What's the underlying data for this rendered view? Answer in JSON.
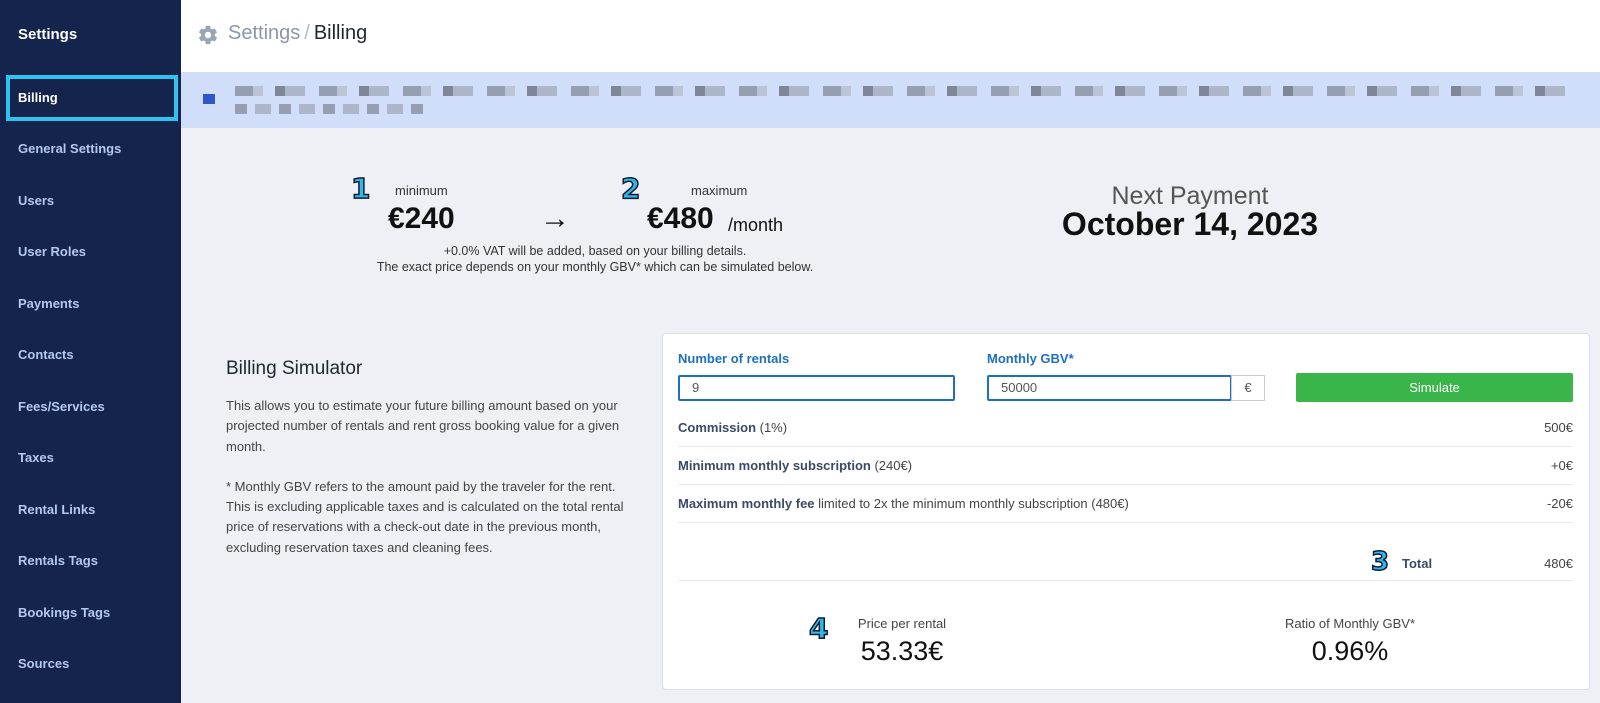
{
  "sidebar": {
    "title": "Settings",
    "items": [
      {
        "label": "Billing",
        "active": true
      },
      {
        "label": "General Settings"
      },
      {
        "label": "Users"
      },
      {
        "label": "User Roles"
      },
      {
        "label": "Payments"
      },
      {
        "label": "Contacts"
      },
      {
        "label": "Fees/Services"
      },
      {
        "label": "Taxes"
      },
      {
        "label": "Rental Links"
      },
      {
        "label": "Rentals Tags"
      },
      {
        "label": "Bookings Tags"
      },
      {
        "label": "Sources"
      }
    ]
  },
  "header": {
    "crumb_parent": "Settings",
    "crumb_sep": "/",
    "crumb_current": "Billing",
    "icon": "gear-icon"
  },
  "banner": {
    "icon": "info-square-icon"
  },
  "pricing": {
    "badge_min": "1",
    "badge_max": "2",
    "min_label": "minimum",
    "min_price": "€240",
    "arrow": "→",
    "max_label": "maximum",
    "max_price": "€480",
    "per_month": "/month",
    "vat_note": "+0.0% VAT will be added, based on your billing details.",
    "gbv_note": "The exact price depends on your monthly GBV* which can be simulated below."
  },
  "next_payment": {
    "label": "Next Payment",
    "date": "October 14, 2023"
  },
  "simulator": {
    "title": "Billing Simulator",
    "desc1": "This allows you to estimate your future billing amount based on your projected number of rentals and rent gross booking value for a given month.",
    "desc2": "* Monthly GBV refers to the amount paid by the traveler for the rent. This is excluding applicable taxes and is calculated on the total rental price of reservations with a check-out date in the previous month, excluding reservation taxes and cleaning fees."
  },
  "form": {
    "rentals_label": "Number of rentals",
    "rentals_value": "9",
    "gbv_label": "Monthly GBV*",
    "gbv_value": "50000",
    "currency": "€",
    "simulate_label": "Simulate"
  },
  "breakdown": {
    "commission_label": "Commission",
    "commission_detail": " (1%)",
    "commission_value": "500€",
    "min_sub_label": "Minimum monthly subscription",
    "min_sub_detail": " (240€)",
    "min_sub_value": "+0€",
    "max_fee_label": "Maximum monthly fee",
    "max_fee_detail": " limited to 2x the minimum monthly subscription (480€)",
    "max_fee_value": "-20€",
    "badge_total": "3",
    "total_label": "Total",
    "total_value": "480€"
  },
  "stats": {
    "badge": "4",
    "price_per_rental_label": "Price per rental",
    "price_per_rental_value": "53.33€",
    "ratio_label": "Ratio of Monthly GBV*",
    "ratio_value": "0.96%"
  },
  "colors": {
    "sidebar_bg": "#15244c",
    "active_border": "#2ec4f2",
    "primary_blue": "#1d6fc2",
    "simulate_green": "#3ab54a",
    "banner_bg": "#d1defa"
  }
}
